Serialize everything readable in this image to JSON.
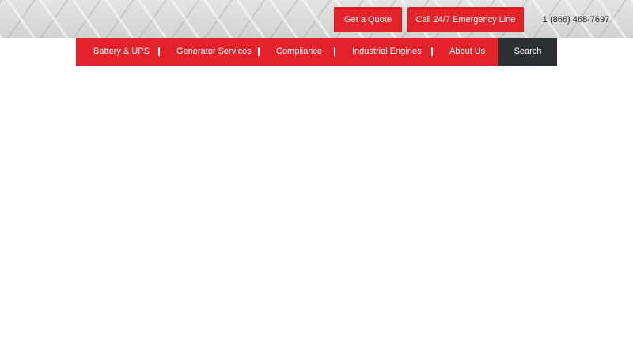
{
  "header": {
    "quote_button": "Get a Quote",
    "emergency_button": "Call 24/7 Emergency Line",
    "phone": "1 (866) 468-7697"
  },
  "nav": {
    "items": [
      {
        "label": "Battery & UPS"
      },
      {
        "label": "Generator Services"
      },
      {
        "label": "Compliance"
      },
      {
        "label": "Industrial Engines"
      },
      {
        "label": "About Us"
      }
    ],
    "search_label": "Search"
  },
  "colors": {
    "accent_red": "#e3222a",
    "search_dark": "#2b3032",
    "topbar_metal": "#dcdcdc"
  }
}
